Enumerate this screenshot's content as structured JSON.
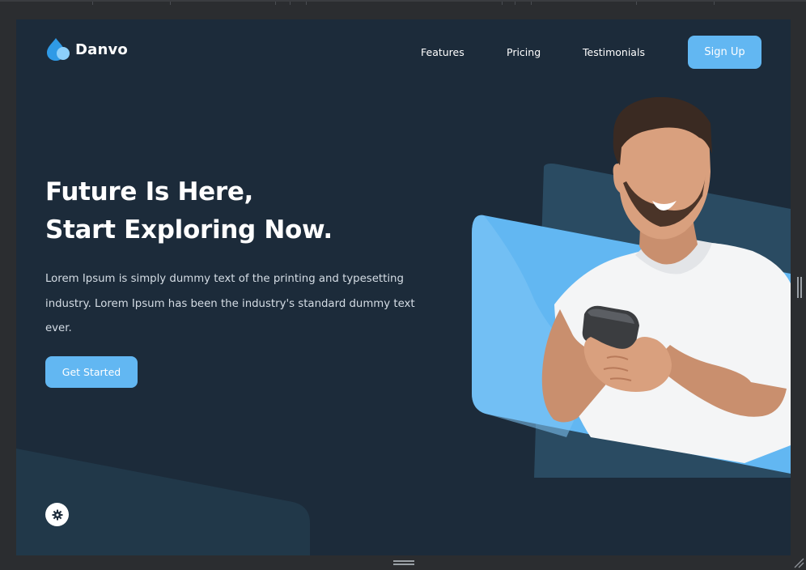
{
  "brand": {
    "name": "Danvo"
  },
  "nav": {
    "features": "Features",
    "pricing": "Pricing",
    "testimonials": "Testimonials",
    "signup": "Sign Up"
  },
  "hero": {
    "title_line1": "Future Is Here,",
    "title_line2": "Start Exploring Now.",
    "description": "Lorem Ipsum is simply dummy text of the printing and typesetting industry. Lorem Ipsum has been the industry's standard dummy text ever.",
    "cta": "Get Started"
  },
  "colors": {
    "background": "#1c2b3a",
    "accent": "#62b7f2",
    "panel": "#2a4b62",
    "text": "#ffffff"
  },
  "icons": {
    "logo": "water-drop-icon",
    "settings": "gear-icon"
  }
}
